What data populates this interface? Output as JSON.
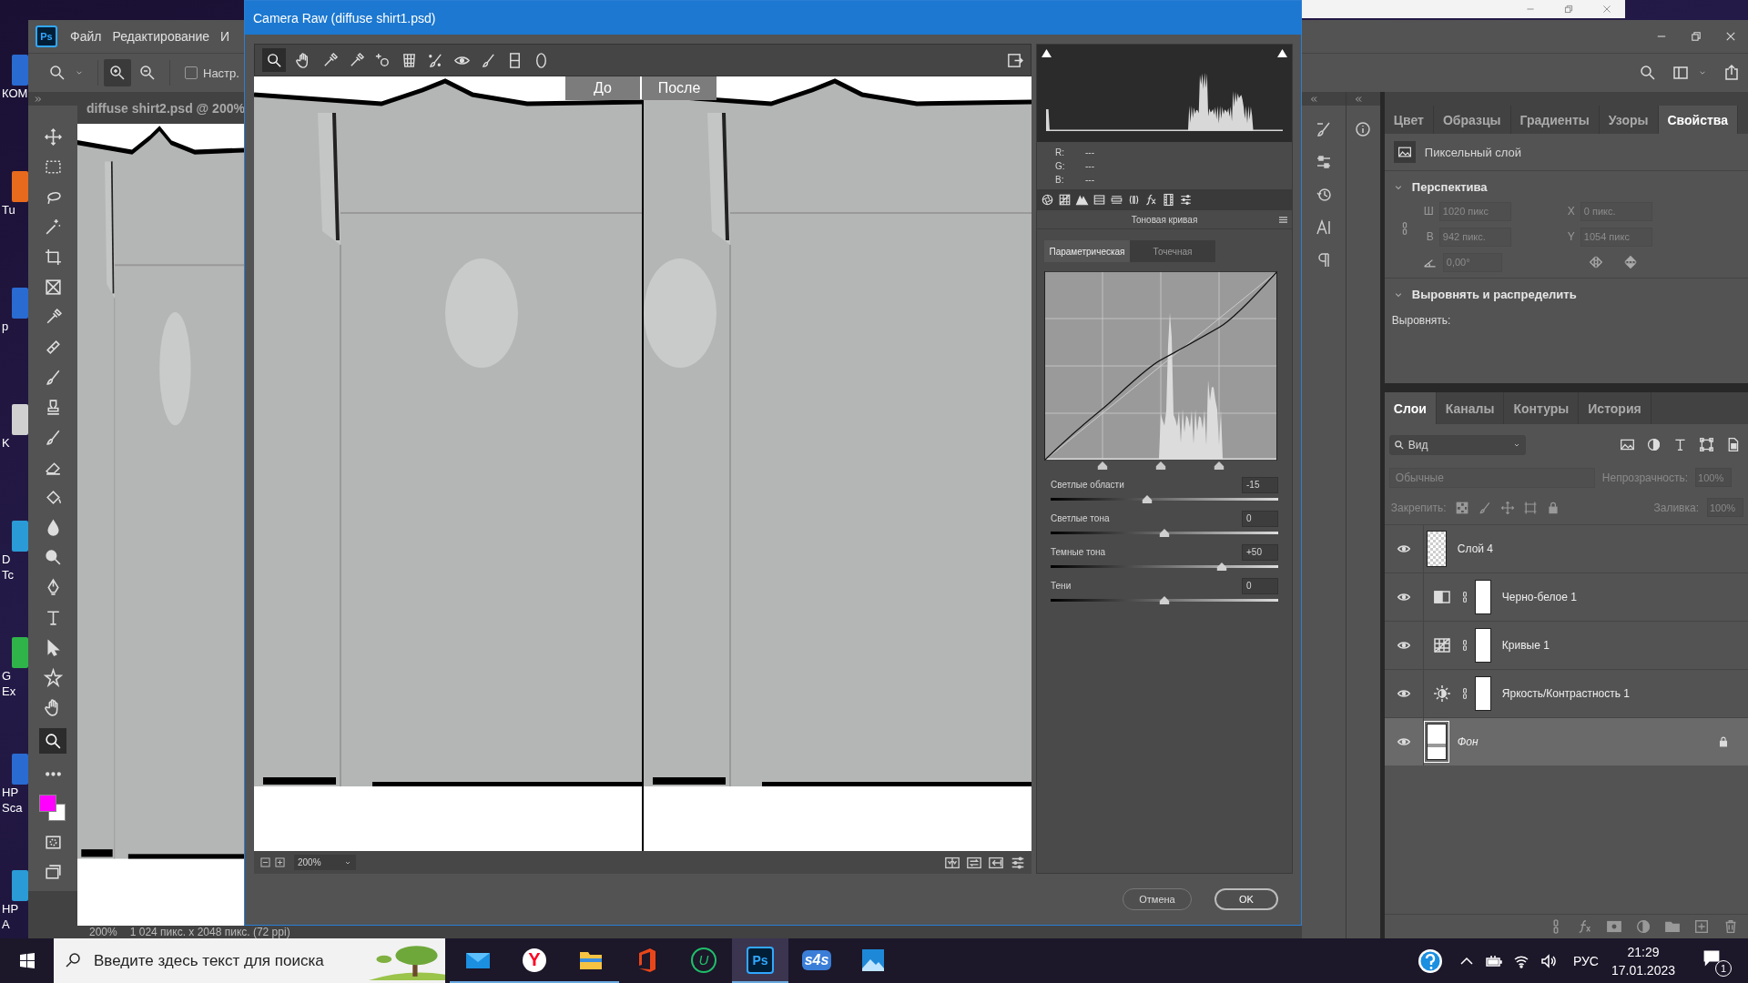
{
  "desktop_icons": [
    {
      "lines": [
        "КОМ"
      ]
    },
    {
      "lines": [
        "Tu"
      ]
    },
    {
      "lines": [
        "p"
      ]
    },
    {
      "lines": [
        "K"
      ]
    },
    {
      "lines": [
        "D",
        "Tc"
      ]
    },
    {
      "lines": [
        "G",
        "Ex"
      ]
    },
    {
      "lines": [
        "HP",
        "Sca"
      ]
    },
    {
      "lines": [
        "HP",
        "A"
      ]
    }
  ],
  "photoshop": {
    "logo": "Ps",
    "menu": [
      "Файл",
      "Редактирование",
      "И"
    ],
    "options": {
      "label": "Настр.",
      "checked": false
    },
    "document_tab": "diffuse shirt2.psd @ 200%",
    "status_bar": {
      "zoom": "200%",
      "info": "1 024 пикс. x 2048 пикс. (72 ppi)"
    }
  },
  "camera_raw": {
    "title": "Camera Raw (diffuse shirt1.psd)",
    "before_label": "До",
    "after_label": "После",
    "zoom": "200%",
    "readout": [
      {
        "label": "R:",
        "value": "---"
      },
      {
        "label": "G:",
        "value": "---"
      },
      {
        "label": "B:",
        "value": "---"
      }
    ],
    "panel_title": "Тоновая кривая",
    "curve_tabs": [
      {
        "label": "Параметрическая",
        "selected": true
      },
      {
        "label": "Точечная",
        "selected": false
      }
    ],
    "sliders": [
      {
        "label": "Светлые области",
        "value": "-15",
        "level": 0.425
      },
      {
        "label": "Светлые тона",
        "value": "0",
        "level": 0.5
      },
      {
        "label": "Темные тона",
        "value": "+50",
        "level": 0.75
      },
      {
        "label": "Тени",
        "value": "0",
        "level": 0.5
      }
    ],
    "buttons": [
      {
        "label": "Отмена",
        "default": false
      },
      {
        "label": "OK",
        "default": true
      }
    ]
  },
  "properties_panel": {
    "tabs": [
      {
        "label": "Цвет",
        "selected": false
      },
      {
        "label": "Образцы",
        "selected": false
      },
      {
        "label": "Градиенты",
        "selected": false
      },
      {
        "label": "Узоры",
        "selected": false
      },
      {
        "label": "Свойства",
        "selected": true
      }
    ],
    "layer_type": "Пиксельный слой",
    "perspective": {
      "title": "Перспектива",
      "expanded": true,
      "disabled": true,
      "fields": [
        {
          "label": "Ш",
          "value": "1020 пикс"
        },
        {
          "label": "X",
          "value": "0 пикс."
        },
        {
          "label": "В",
          "value": "942 пикс."
        },
        {
          "label": "Y",
          "value": "1054 пикс"
        }
      ],
      "angle": "0,00°"
    },
    "align": {
      "title": "Выровнять и распределить",
      "expanded": true,
      "label": "Выровнять:"
    }
  },
  "layers_panel": {
    "tabs": [
      {
        "label": "Слои",
        "selected": true
      },
      {
        "label": "Каналы",
        "selected": false
      },
      {
        "label": "Контуры",
        "selected": false
      },
      {
        "label": "История",
        "selected": false
      }
    ],
    "filter": "Вид",
    "blend_mode": "Обычные",
    "opacity_label": "Непрозрачность:",
    "opacity": "100%",
    "lock_label": "Закрепить:",
    "fill_label": "Заливка:",
    "fill": "100%",
    "layers": [
      {
        "name": "Слой 4",
        "kind": "pixel",
        "visible": true,
        "selected": false,
        "locked": false
      },
      {
        "name": "Черно-белое 1",
        "kind": "black-white",
        "visible": true,
        "selected": false,
        "locked": false
      },
      {
        "name": "Кривые 1",
        "kind": "curves",
        "visible": true,
        "selected": false,
        "locked": false
      },
      {
        "name": "Яркость/Контрастность 1",
        "kind": "brightness",
        "visible": true,
        "selected": false,
        "locked": false
      },
      {
        "name": "Фон",
        "kind": "background",
        "visible": true,
        "selected": true,
        "locked": true
      }
    ]
  },
  "taskbar": {
    "search_placeholder": "Введите здесь текст для поиска",
    "apps": [
      {
        "kind": "mail",
        "running": true,
        "active": false
      },
      {
        "kind": "browser",
        "text": "Y",
        "running": true,
        "active": false
      },
      {
        "kind": "folder",
        "running": true,
        "active": false
      },
      {
        "kind": "office",
        "running": false,
        "active": false
      },
      {
        "kind": "ring",
        "text": "U",
        "running": false,
        "active": false
      },
      {
        "kind": "ps",
        "text": "Ps",
        "running": true,
        "active": true
      },
      {
        "kind": "s4s",
        "text": "s4s",
        "running": false,
        "active": false
      },
      {
        "kind": "photos",
        "running": false,
        "active": false
      }
    ],
    "language": "РУС",
    "time": "21:29",
    "date": "17.01.2023",
    "notifications": "1"
  }
}
